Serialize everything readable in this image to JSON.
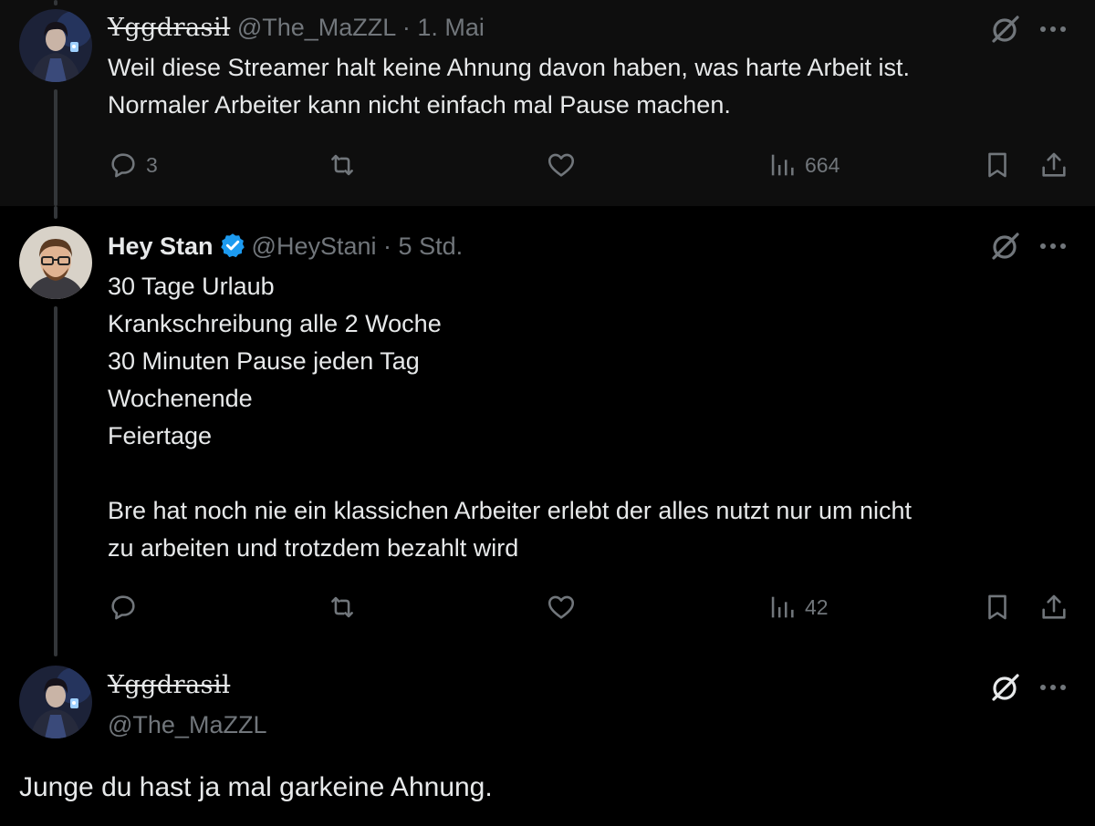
{
  "tweets": [
    {
      "display_name": "Yggdrasil",
      "handle": "@The_MaZZL",
      "separator": "·",
      "time": "1. Mai",
      "text": "Weil diese Streamer halt keine Ahnung davon haben, was harte Arbeit ist.\nNormaler Arbeiter kann nicht einfach mal Pause machen.",
      "replies": "3",
      "reposts": "",
      "likes": "",
      "views": "664"
    },
    {
      "display_name": "Hey Stan",
      "verified": true,
      "handle": "@HeyStani",
      "separator": "·",
      "time": "5 Std.",
      "text": "30 Tage Urlaub\nKrankschreibung alle 2 Woche\n30 Minuten Pause jeden Tag\nWochenende\nFeiertage\n\nBre hat noch nie ein klassichen Arbeiter erlebt der alles nutzt nur um nicht\nzu arbeiten und trotzdem bezahlt wird",
      "replies": "",
      "reposts": "",
      "likes": "",
      "views": "42"
    },
    {
      "display_name": "Yggdrasil",
      "handle": "@The_MaZZL",
      "text": "Junge du hast ja mal garkeine Ahnung."
    }
  ],
  "icons": {
    "reply": "reply-icon",
    "repost": "repost-icon",
    "like": "heart-icon",
    "views": "views-icon",
    "bookmark": "bookmark-icon",
    "share": "share-icon",
    "grok": "grok-icon",
    "more": "more-icon"
  },
  "colors": {
    "background": "#000000",
    "highlight_background": "#0e0e0e",
    "text": "#e7e9ea",
    "secondary_text": "#71767b",
    "verified_blue": "#1d9bf0",
    "thread_line": "#333639"
  }
}
